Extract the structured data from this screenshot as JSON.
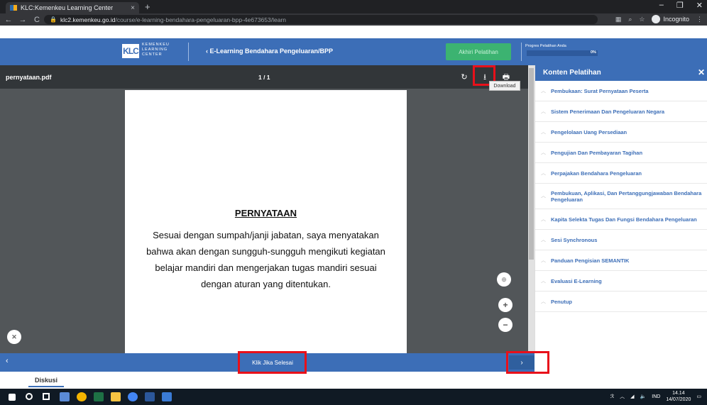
{
  "browser": {
    "tab_title": "KLC:Kemenkeu Learning Center",
    "tab_close": "×",
    "new_tab": "+",
    "url_host": "klc2.kemenkeu.go.id",
    "url_path": "/course/e-learning-bendahara-pengeluaran-bpp-4e673653/learn",
    "incognito_label": "Incognito",
    "win_min": "–",
    "win_max": "❐",
    "win_close": "✕"
  },
  "header": {
    "logo_mark": "KLC",
    "logo_lines": [
      "KEMENKEU",
      "LEARNING",
      "CENTER"
    ],
    "course_link": "‹ E-Learning Bendahara Pengeluaran/BPP",
    "finish_button": "Akhiri Pelatihan",
    "progress_label": "Progres Pelatihan Anda",
    "progress_text": "0%",
    "progress_value": 0
  },
  "pdf": {
    "filename": "pernyataan.pdf",
    "page_count": "1 / 1",
    "tooltip": "Download",
    "doc_title": "PERNYATAAN",
    "doc_body": "Sesuai dengan sumpah/janji jabatan, saya menyatakan bahwa akan dengan sungguh-sungguh  mengikuti kegiatan belajar mandiri dan mengerjakan tugas mandiri sesuai dengan aturan yang ditentukan."
  },
  "sidebar": {
    "title": "Konten Pelatihan",
    "close": "✕",
    "items": [
      {
        "label": "Pembukaan: Surat Pernyataan Peserta"
      },
      {
        "label": "Sistem Penerimaan Dan Pengeluaran Negara"
      },
      {
        "label": "Pengelolaan Uang Persediaan"
      },
      {
        "label": "Pengujian Dan Pembayaran Tagihan"
      },
      {
        "label": "Perpajakan Bendahara Pengeluaran"
      },
      {
        "label": "Pembukuan, Aplikasi, Dan Pertanggungjawaban Bendahara Pengeluaran"
      },
      {
        "label": "Kapita Selekta Tugas Dan Fungsi Bendahara Pengeluaran"
      },
      {
        "label": "Sesi Synchronous"
      },
      {
        "label": "Panduan Pengisian SEMANTIK"
      },
      {
        "label": "Evaluasi E-Learning"
      },
      {
        "label": "Penutup"
      }
    ]
  },
  "bottombar": {
    "prev": "‹",
    "done_button": "Klik Jika Selesai",
    "next": "›"
  },
  "discussion_tab": "Diskusi",
  "taskbar": {
    "lang": "IND",
    "time": "14.14",
    "date": "14/07/2020"
  },
  "colors": {
    "brand_blue": "#3c6eb7",
    "finish_green": "#3cb371",
    "highlight_red": "#e8101a"
  }
}
